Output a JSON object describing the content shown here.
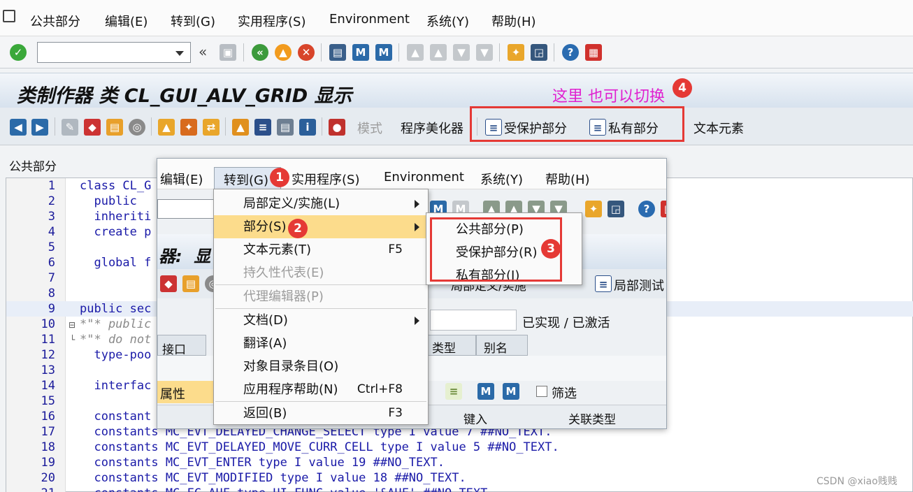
{
  "menu": [
    "公共部分",
    "编辑(E)",
    "转到(G)",
    "实用程序(S)",
    "Environment",
    "系统(Y)",
    "帮助(H)"
  ],
  "title": "类制作器 类 CL_GUI_ALV_GRID 显示",
  "toolbar2": {
    "mode": "模式",
    "pretty_printer": "程序美化器",
    "protected": "受保护部分",
    "private": "私有部分",
    "text_elements": "文本元素"
  },
  "annotation": "这里 也可以切换",
  "section_label": "公共部分",
  "code_lines": [
    {
      "n": "1",
      "t": "class CL_G",
      "c": "normal"
    },
    {
      "n": "2",
      "t": "  public",
      "c": "normal"
    },
    {
      "n": "3",
      "t": "  inheriti",
      "c": "normal"
    },
    {
      "n": "4",
      "t": "  create p",
      "c": "normal"
    },
    {
      "n": "5",
      "t": "",
      "c": "normal"
    },
    {
      "n": "6",
      "t": "  global f",
      "c": "normal"
    },
    {
      "n": "7",
      "t": "",
      "c": "normal"
    },
    {
      "n": "8",
      "t": "",
      "c": "normal"
    },
    {
      "n": "9",
      "t": "public sec",
      "c": "normal"
    },
    {
      "n": "10",
      "t": "*\"* public",
      "c": "comment"
    },
    {
      "n": "11",
      "t": "*\"* do not",
      "c": "comment"
    },
    {
      "n": "12",
      "t": "  type-poo",
      "c": "normal"
    },
    {
      "n": "13",
      "t": "",
      "c": "normal"
    },
    {
      "n": "14",
      "t": "  interfac",
      "c": "normal"
    },
    {
      "n": "15",
      "t": "",
      "c": "normal"
    },
    {
      "n": "16",
      "t": "  constant",
      "c": "normal"
    },
    {
      "n": "17",
      "t": "  constants MC_EVT_DELAYED_CHANGE_SELECT type I value 7 ##NO_TEXT.",
      "c": "normal"
    },
    {
      "n": "18",
      "t": "  constants MC_EVT_DELAYED_MOVE_CURR_CELL type I value 5 ##NO_TEXT.",
      "c": "normal"
    },
    {
      "n": "19",
      "t": "  constants MC_EVT_ENTER type I value 19 ##NO_TEXT.",
      "c": "normal"
    },
    {
      "n": "20",
      "t": "  constants MC_EVT_MODIFIED type I value 18 ##NO_TEXT.",
      "c": "normal"
    },
    {
      "n": "21",
      "t": "  constants MC_FC_AUF type UI_FUNC value '&AUF' ##NO_TEXT.",
      "c": "normal"
    }
  ],
  "window2": {
    "menu": [
      "编辑(E)",
      "转到(G)",
      "实用程序(S)",
      "Environment",
      "系统(Y)",
      "帮助(H)"
    ],
    "title_fragment": "器:  显",
    "status": "已实现 / 已激活",
    "tabs": [
      "接口",
      "类型",
      "别名"
    ],
    "attr_label": "属性",
    "filter_label": "筛选",
    "col_headers": [
      "键入",
      "关联类型"
    ],
    "local_def_text": "局部定义/实施",
    "local_test": "局部测试"
  },
  "dropdown": [
    {
      "label": "局部定义/实施(L)",
      "shortcut": "",
      "submenu": true,
      "disabled": false
    },
    {
      "label": "部分(S)",
      "shortcut": "",
      "submenu": true,
      "disabled": false,
      "highlight": true
    },
    {
      "label": "文本元素(T)",
      "shortcut": "F5",
      "submenu": false,
      "disabled": false
    },
    {
      "label": "持久性代表(E)",
      "shortcut": "",
      "submenu": false,
      "disabled": true
    },
    {
      "label": "代理编辑器(P)",
      "shortcut": "",
      "submenu": false,
      "disabled": true
    },
    {
      "label": "文档(D)",
      "shortcut": "",
      "submenu": true,
      "disabled": false
    },
    {
      "label": "翻译(A)",
      "shortcut": "",
      "submenu": false,
      "disabled": false
    },
    {
      "label": "对象目录条目(O)",
      "shortcut": "",
      "submenu": false,
      "disabled": false
    },
    {
      "label": "应用程序帮助(N)",
      "shortcut": "Ctrl+F8",
      "submenu": false,
      "disabled": false
    },
    {
      "label": "返回(B)",
      "shortcut": "F3",
      "submenu": false,
      "disabled": false
    }
  ],
  "submenu": [
    "公共部分(P)",
    "受保护部分(R)",
    "私有部分(I)"
  ],
  "badges": [
    "1",
    "2",
    "3",
    "4"
  ],
  "watermark": "CSDN @xiao贱贱",
  "colors": {
    "highlight": "#fcdc8c",
    "annotation": "#e020d0",
    "red": "#e53935"
  }
}
